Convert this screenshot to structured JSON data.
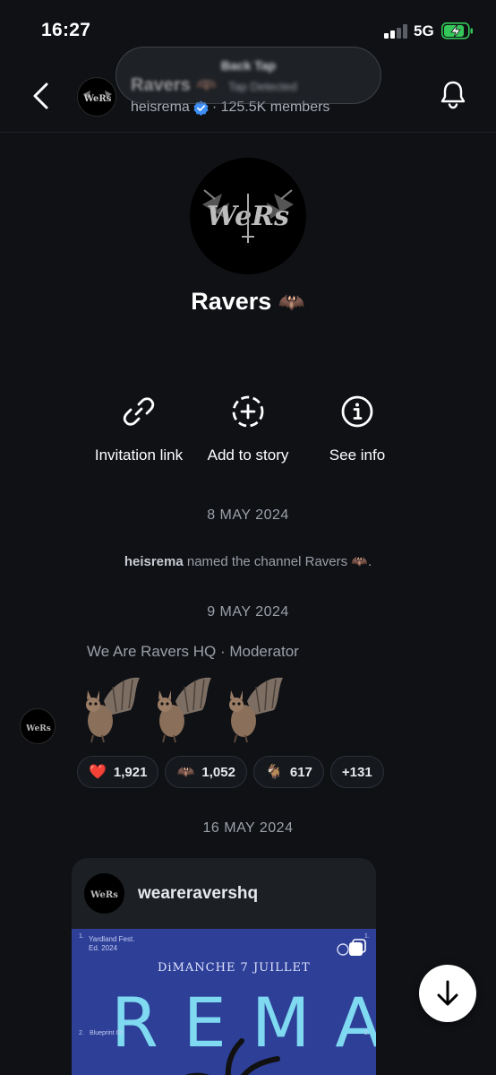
{
  "status_bar": {
    "time": "16:27",
    "network": "5G"
  },
  "header": {
    "title": "Ravers 🦇",
    "owner": "heisrema",
    "members": "· 125.5K members"
  },
  "toast": {
    "title": "Back Tap",
    "subtitle": "Tap Detected"
  },
  "profile": {
    "name": "Ravers",
    "emoji": "🦇",
    "logo_text": "WeRs"
  },
  "actions": [
    {
      "label": "Invitation link",
      "icon": "link-icon"
    },
    {
      "label": "Add to story",
      "icon": "add-story-icon"
    },
    {
      "label": "See info",
      "icon": "info-icon"
    }
  ],
  "feed": {
    "date1": "8 MAY 2024",
    "system_message": {
      "user": "heisrema",
      "text": " named the channel Ravers 🦇."
    },
    "date2": "9 MAY 2024",
    "sender": "We Are Ravers HQ · Moderator",
    "message_emojis": [
      "🦇",
      "🦇",
      "🦇"
    ],
    "reactions": [
      {
        "emoji": "❤️",
        "count": "1,921"
      },
      {
        "emoji": "🦇",
        "count": "1,052"
      },
      {
        "emoji": "🐐",
        "count": "617"
      },
      {
        "emoji": "",
        "count": "+131"
      }
    ],
    "date3": "16 MAY 2024",
    "post": {
      "username": "weareravershq",
      "poster": {
        "fest": "Yardland Fest.",
        "edition": "Ed. 2024",
        "date": "DiMANCHE 7 JUILLET",
        "artist": "REMA",
        "blueprint": "Blueprint 00",
        "mark1": "1.",
        "mark2": "2."
      }
    }
  },
  "colors": {
    "background": "#0f1115",
    "verified": "#3d8ef7",
    "poster": "#2d3f97"
  }
}
